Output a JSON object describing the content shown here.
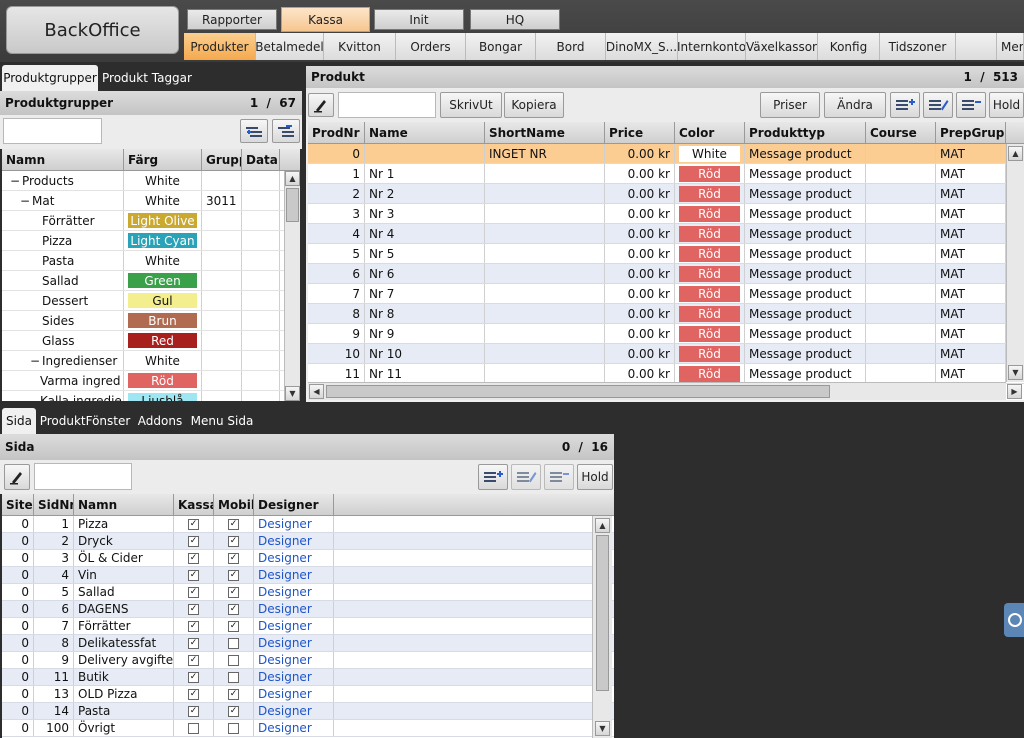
{
  "app": {
    "title": "BackOffice"
  },
  "main_tabs": [
    {
      "label": "Rapporter"
    },
    {
      "label": "Kassa"
    },
    {
      "label": "Init"
    },
    {
      "label": "HQ"
    }
  ],
  "sub_tabs": [
    {
      "label": "Produkter"
    },
    {
      "label": "Betalmedel"
    },
    {
      "label": "Kvitton"
    },
    {
      "label": "Orders"
    },
    {
      "label": "Bongar"
    },
    {
      "label": "Bord"
    },
    {
      "label": "DinoMX_S..."
    },
    {
      "label": "Internkonto"
    },
    {
      "label": "Växelkassor"
    },
    {
      "label": "Konfig"
    },
    {
      "label": "Tidszoner"
    },
    {
      "label": "Mer"
    }
  ],
  "left_panel": {
    "tabs": [
      {
        "label": "Produktgrupper"
      },
      {
        "label": "Produkt Taggar"
      }
    ],
    "header": "Produktgrupper",
    "page": "1",
    "sep": "/",
    "total": "67",
    "search_value": "",
    "columns": [
      "Namn",
      "Färg",
      "Grupp",
      "Data"
    ],
    "rows": [
      {
        "expander": "−",
        "name": "Products",
        "color": "White",
        "color_hex": "#ffffff",
        "text_hex": "#111111",
        "group": "",
        "indent": 1
      },
      {
        "expander": "−",
        "name": "Mat",
        "color": "White",
        "color_hex": "#ffffff",
        "text_hex": "#111111",
        "group": "3011",
        "indent": 2
      },
      {
        "expander": "",
        "name": "Förrätter",
        "color": "Light Olive",
        "color_hex": "#c9a930",
        "text_hex": "#ffffff",
        "group": "",
        "indent": 3
      },
      {
        "expander": "",
        "name": "Pizza",
        "color": "Light Cyan",
        "color_hex": "#2aa3b8",
        "text_hex": "#ffffff",
        "group": "",
        "indent": 3
      },
      {
        "expander": "",
        "name": "Pasta",
        "color": "White",
        "color_hex": "#ffffff",
        "text_hex": "#111111",
        "group": "",
        "indent": 3
      },
      {
        "expander": "",
        "name": "Sallad",
        "color": "Green",
        "color_hex": "#3aa14a",
        "text_hex": "#ffffff",
        "group": "",
        "indent": 3
      },
      {
        "expander": "",
        "name": "Dessert",
        "color": "Gul",
        "color_hex": "#f3ef8e",
        "text_hex": "#111111",
        "group": "",
        "indent": 3
      },
      {
        "expander": "",
        "name": "Sides",
        "color": "Brun",
        "color_hex": "#b06b50",
        "text_hex": "#ffffff",
        "group": "",
        "indent": 3
      },
      {
        "expander": "",
        "name": "Glass",
        "color": "Red",
        "color_hex": "#a8201d",
        "text_hex": "#ffffff",
        "group": "",
        "indent": 3
      },
      {
        "expander": "−",
        "name": "Ingredienser",
        "color": "White",
        "color_hex": "#ffffff",
        "text_hex": "#111111",
        "group": "",
        "indent": 3
      },
      {
        "expander": "",
        "name": "Varma ingred",
        "color": "Röd",
        "color_hex": "#e06462",
        "text_hex": "#ffffff",
        "group": "",
        "indent": 4
      },
      {
        "expander": "",
        "name": "Kalla ingredie",
        "color": "Ljusblå",
        "color_hex": "#9ee6f2",
        "text_hex": "#111111",
        "group": "",
        "indent": 4
      }
    ]
  },
  "product_panel": {
    "header": "Produkt",
    "page": "1",
    "sep": "/",
    "total": "513",
    "search_value": "",
    "buttons": {
      "print": "SkrivUt",
      "copy": "Kopiera",
      "prices": "Priser",
      "edit": "Ändra",
      "hold": "Hold"
    },
    "columns": [
      "ProdNr",
      "Name",
      "ShortName",
      "Price",
      "Color",
      "Produkttyp",
      "Course",
      "PrepGrupp"
    ],
    "rows": [
      {
        "prodnr": "0",
        "name": "",
        "short": "INGET NR",
        "price": "0.00 kr",
        "color": "White",
        "color_hex": "#ffffff",
        "text_hex": "#111111",
        "type": "Message product",
        "course": "",
        "prep": "MAT"
      },
      {
        "prodnr": "1",
        "name": "Nr 1",
        "short": "",
        "price": "0.00 kr",
        "color": "Röd",
        "color_hex": "#e06462",
        "text_hex": "#ffffff",
        "type": "Message product",
        "course": "",
        "prep": "MAT"
      },
      {
        "prodnr": "2",
        "name": "Nr 2",
        "short": "",
        "price": "0.00 kr",
        "color": "Röd",
        "color_hex": "#e06462",
        "text_hex": "#ffffff",
        "type": "Message product",
        "course": "",
        "prep": "MAT"
      },
      {
        "prodnr": "3",
        "name": "Nr 3",
        "short": "",
        "price": "0.00 kr",
        "color": "Röd",
        "color_hex": "#e06462",
        "text_hex": "#ffffff",
        "type": "Message product",
        "course": "",
        "prep": "MAT"
      },
      {
        "prodnr": "4",
        "name": "Nr 4",
        "short": "",
        "price": "0.00 kr",
        "color": "Röd",
        "color_hex": "#e06462",
        "text_hex": "#ffffff",
        "type": "Message product",
        "course": "",
        "prep": "MAT"
      },
      {
        "prodnr": "5",
        "name": "Nr 5",
        "short": "",
        "price": "0.00 kr",
        "color": "Röd",
        "color_hex": "#e06462",
        "text_hex": "#ffffff",
        "type": "Message product",
        "course": "",
        "prep": "MAT"
      },
      {
        "prodnr": "6",
        "name": "Nr 6",
        "short": "",
        "price": "0.00 kr",
        "color": "Röd",
        "color_hex": "#e06462",
        "text_hex": "#ffffff",
        "type": "Message product",
        "course": "",
        "prep": "MAT"
      },
      {
        "prodnr": "7",
        "name": "Nr 7",
        "short": "",
        "price": "0.00 kr",
        "color": "Röd",
        "color_hex": "#e06462",
        "text_hex": "#ffffff",
        "type": "Message product",
        "course": "",
        "prep": "MAT"
      },
      {
        "prodnr": "8",
        "name": "Nr 8",
        "short": "",
        "price": "0.00 kr",
        "color": "Röd",
        "color_hex": "#e06462",
        "text_hex": "#ffffff",
        "type": "Message product",
        "course": "",
        "prep": "MAT"
      },
      {
        "prodnr": "9",
        "name": "Nr 9",
        "short": "",
        "price": "0.00 kr",
        "color": "Röd",
        "color_hex": "#e06462",
        "text_hex": "#ffffff",
        "type": "Message product",
        "course": "",
        "prep": "MAT"
      },
      {
        "prodnr": "10",
        "name": "Nr 10",
        "short": "",
        "price": "0.00 kr",
        "color": "Röd",
        "color_hex": "#e06462",
        "text_hex": "#ffffff",
        "type": "Message product",
        "course": "",
        "prep": "MAT"
      },
      {
        "prodnr": "11",
        "name": "Nr 11",
        "short": "",
        "price": "0.00 kr",
        "color": "Röd",
        "color_hex": "#e06462",
        "text_hex": "#ffffff",
        "type": "Message product",
        "course": "",
        "prep": "MAT"
      }
    ]
  },
  "bottom_panel": {
    "tabs": [
      {
        "label": "Sida"
      },
      {
        "label": "ProduktFönster"
      },
      {
        "label": "Addons"
      },
      {
        "label": "Menu Sida"
      }
    ],
    "header": "Sida",
    "page": "0",
    "sep": "/",
    "total": "16",
    "search_value": "",
    "buttons": {
      "hold": "Hold"
    },
    "columns": [
      "Site",
      "SidNr",
      "Namn",
      "Kassa",
      "Mobil",
      "Designer"
    ],
    "rows": [
      {
        "site": "0",
        "sidnr": "1",
        "name": "Pizza",
        "kassa": true,
        "mobil": true,
        "designer": "Designer"
      },
      {
        "site": "0",
        "sidnr": "2",
        "name": "Dryck",
        "kassa": true,
        "mobil": true,
        "designer": "Designer"
      },
      {
        "site": "0",
        "sidnr": "3",
        "name": "ÖL & Cider",
        "kassa": true,
        "mobil": true,
        "designer": "Designer"
      },
      {
        "site": "0",
        "sidnr": "4",
        "name": "Vin",
        "kassa": true,
        "mobil": true,
        "designer": "Designer"
      },
      {
        "site": "0",
        "sidnr": "5",
        "name": "Sallad",
        "kassa": true,
        "mobil": true,
        "designer": "Designer"
      },
      {
        "site": "0",
        "sidnr": "6",
        "name": "DAGENS",
        "kassa": true,
        "mobil": true,
        "designer": "Designer"
      },
      {
        "site": "0",
        "sidnr": "7",
        "name": "Förrätter",
        "kassa": true,
        "mobil": true,
        "designer": "Designer"
      },
      {
        "site": "0",
        "sidnr": "8",
        "name": "Delikatessfat",
        "kassa": true,
        "mobil": false,
        "designer": "Designer"
      },
      {
        "site": "0",
        "sidnr": "9",
        "name": "Delivery avgifter",
        "kassa": true,
        "mobil": false,
        "designer": "Designer"
      },
      {
        "site": "0",
        "sidnr": "11",
        "name": "Butik",
        "kassa": true,
        "mobil": false,
        "designer": "Designer"
      },
      {
        "site": "0",
        "sidnr": "13",
        "name": "OLD Pizza",
        "kassa": true,
        "mobil": true,
        "designer": "Designer"
      },
      {
        "site": "0",
        "sidnr": "14",
        "name": "Pasta",
        "kassa": true,
        "mobil": true,
        "designer": "Designer"
      },
      {
        "site": "0",
        "sidnr": "100",
        "name": "Övrigt",
        "kassa": false,
        "mobil": false,
        "designer": "Designer"
      }
    ]
  },
  "colors": {
    "accent": "#f5a94e",
    "selected_row": "#fbcd92",
    "alt_row": "#e6ebf5",
    "link": "#1f55c8",
    "dark_bg": "#2d2d2d"
  }
}
